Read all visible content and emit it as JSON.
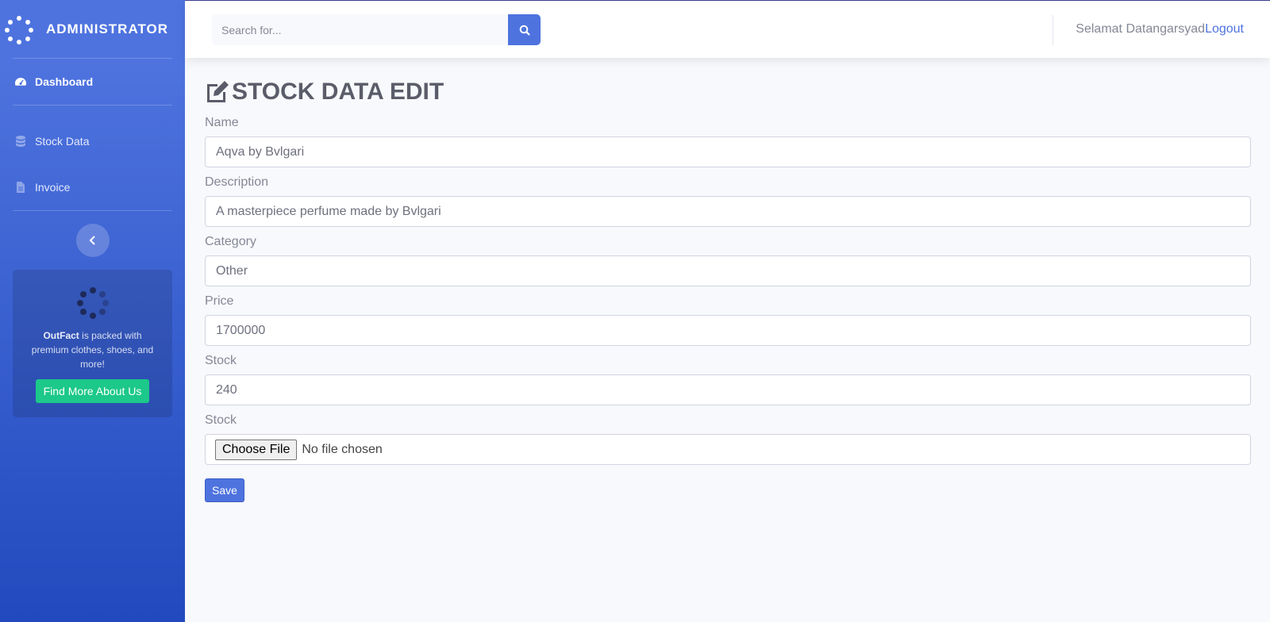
{
  "sidebar": {
    "brand": "ADMINISTRATOR",
    "items": [
      {
        "label": "Dashboard",
        "icon": "tachometer-icon"
      },
      {
        "label": "Stock Data",
        "icon": "database-icon"
      },
      {
        "label": "Invoice",
        "icon": "file-icon"
      }
    ],
    "promo": {
      "brand": "OutFact",
      "text": " is packed with premium clothes, shoes, and more!",
      "button": "Find More About Us"
    }
  },
  "topbar": {
    "search_placeholder": "Search for...",
    "greeting": "Selamat Datangarsyad",
    "logout": "Logout"
  },
  "form": {
    "title": "STOCK DATA EDIT",
    "fields": [
      {
        "label": "Name",
        "value": "Aqva by Bvlgari"
      },
      {
        "label": "Description",
        "value": "A masterpiece perfume made by Bvlgari"
      },
      {
        "label": "Category",
        "value": "Other"
      },
      {
        "label": "Price",
        "value": "1700000"
      },
      {
        "label": "Stock",
        "value": "240"
      }
    ],
    "file": {
      "label": "Stock",
      "button": "Choose File",
      "status": "No file chosen"
    },
    "save": "Save"
  },
  "colors": {
    "primary": "#4e73df",
    "success": "#1cc88a",
    "text": "#858796"
  }
}
